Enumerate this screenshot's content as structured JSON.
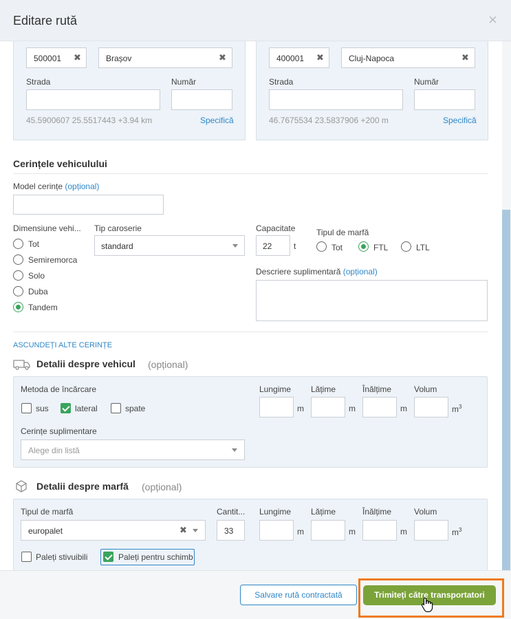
{
  "header": {
    "title": "Editare rută",
    "close": "×"
  },
  "pickup": {
    "postal_code": "500001",
    "city": "Brașov",
    "street_label": "Strada",
    "number_label": "Număr",
    "coords": "45.5900607 25.5517443 +3.94 km",
    "specify": "Specifică"
  },
  "delivery": {
    "postal_code": "400001",
    "city": "Cluj-Napoca",
    "street_label": "Strada",
    "number_label": "Număr",
    "coords": "46.7675534 23.5837906 +200 m",
    "specify": "Specifică"
  },
  "vehicle_req": {
    "title": "Cerințele vehiculului",
    "model_label": "Model cerințe",
    "optional": "(opțional)",
    "dimension_label": "Dimensiune vehi...",
    "dimension_options": [
      "Tot",
      "Semiremorca",
      "Solo",
      "Duba",
      "Tandem"
    ],
    "dimension_selected": "Tandem",
    "body_type_label": "Tip caroserie",
    "body_type_value": "standard",
    "capacity_label": "Capacitate",
    "capacity_value": "22",
    "capacity_unit": "t",
    "cargo_type_label": "Tipul de marfă",
    "cargo_options": [
      "Tot",
      "FTL",
      "LTL"
    ],
    "cargo_selected": "FTL",
    "extra_desc_label": "Descriere suplimentară",
    "extra_desc_optional": "(opțional)",
    "hide_link": "ASCUNDEȚI ALTE CERINȚE"
  },
  "vehicle_details": {
    "title": "Detalii despre vehicul",
    "optional": "(opțional)",
    "loading_label": "Metoda de încărcare",
    "loading_options": [
      {
        "label": "sus",
        "checked": false
      },
      {
        "label": "lateral",
        "checked": true
      },
      {
        "label": "spate",
        "checked": false
      }
    ],
    "length_label": "Lungime",
    "width_label": "Lățime",
    "height_label": "Înălțime",
    "volume_label": "Volum",
    "unit_m": "m",
    "unit_m3": "m",
    "unit_sup": "3",
    "extra_label": "Cerințe suplimentare",
    "extra_placeholder": "Alege din listă"
  },
  "cargo_details": {
    "title": "Detalii despre marfă",
    "optional": "(opțional)",
    "type_label": "Tipul de marfă",
    "type_value": "europalet",
    "qty_label": "Cantit...",
    "qty_value": "33",
    "length_label": "Lungime",
    "width_label": "Lățime",
    "height_label": "Înălțime",
    "volume_label": "Volum",
    "unit_m": "m",
    "unit_m3": "m",
    "unit_sup": "3",
    "stackable_label": "Paleți stivuibili",
    "stackable_checked": false,
    "exchange_label": "Paleți pentru schimb",
    "exchange_checked": true
  },
  "footer": {
    "save_button": "Salvare rută contractată",
    "send_button": "Trimiteți către transportatori"
  },
  "colors": {
    "accent_blue": "#2f87c8",
    "green": "#7ba33a",
    "highlight": "#f07a1f"
  }
}
